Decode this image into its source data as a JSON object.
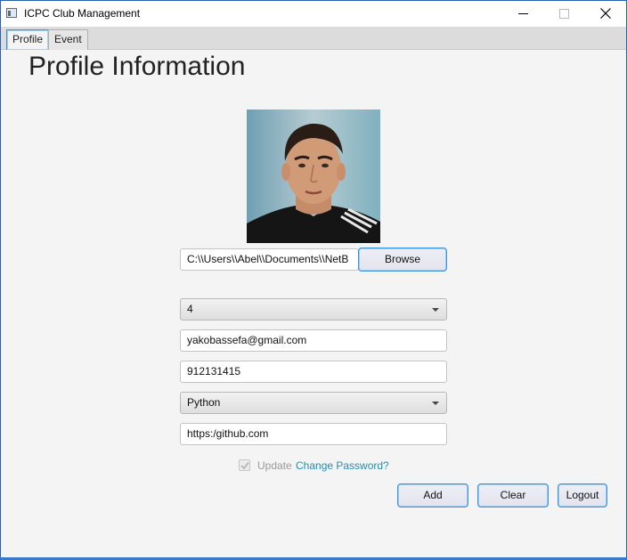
{
  "window": {
    "title": "ICPC Club Management",
    "icon": "app-window-icon"
  },
  "tabs": [
    {
      "label": "Profile",
      "active": true
    },
    {
      "label": "Event",
      "active": false
    }
  ],
  "page": {
    "title": "Profile Information"
  },
  "profile": {
    "photo_path": "C:\\\\Users\\\\Abel\\\\Documents\\\\NetB",
    "browse_label": "Browse",
    "year": "4",
    "email": "yakobassefa@gmail.com",
    "phone": "912131415",
    "language": "Python",
    "github": "https:/github.com",
    "update_checked": true,
    "update_label": "Update",
    "change_password_label": "Change Password?"
  },
  "actions": {
    "add_label": "Add",
    "clear_label": "Clear",
    "logout_label": "Logout"
  },
  "colors": {
    "link": "#1f8fb8",
    "focus_border": "#3d93dc",
    "window_border": "#2b62b0"
  }
}
